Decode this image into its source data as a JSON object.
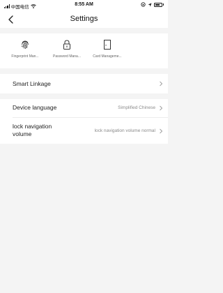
{
  "status_bar": {
    "carrier": "中国电信",
    "time": "8:55 AM"
  },
  "nav": {
    "title": "Settings"
  },
  "shortcuts": [
    {
      "label": "Fingerprint Man...",
      "icon": "fingerprint-icon"
    },
    {
      "label": "Password Mana...",
      "icon": "padlock-icon"
    },
    {
      "label": "Card Manageme...",
      "icon": "door-card-icon"
    }
  ],
  "smart_linkage": {
    "label": "Smart Linkage"
  },
  "device_language": {
    "label": "Device language",
    "value": "Simplified Chinese"
  },
  "lock_navigation_volume": {
    "label_line1": "lock navigation",
    "label_line2": "volume",
    "value": "lock navigation volume normal"
  },
  "colors": {
    "background": "#f4f4f4",
    "panel": "#ffffff",
    "secondary_text": "#8a8a8a"
  }
}
